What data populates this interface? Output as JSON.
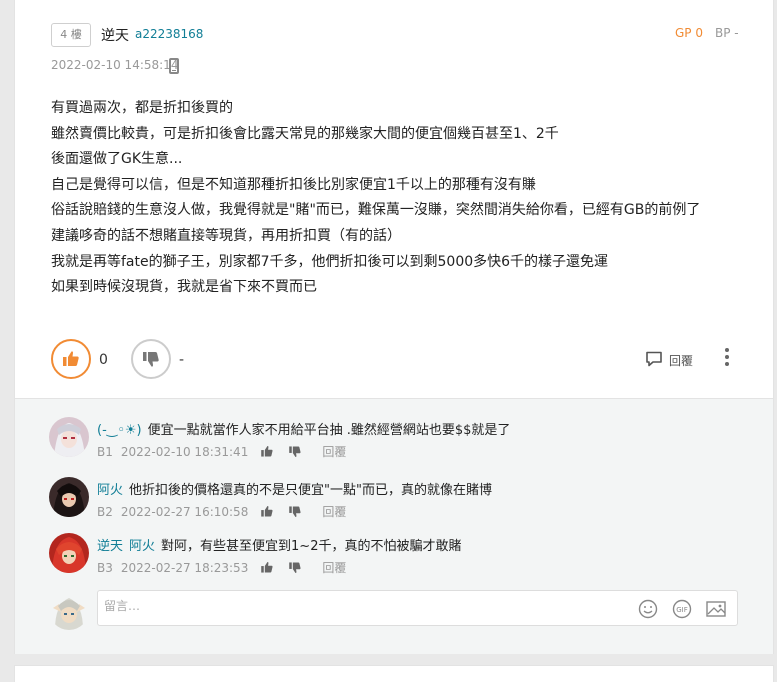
{
  "post": {
    "floor": "4 樓",
    "username": "逆天",
    "user_id": "a22238168",
    "gp": "GP 0",
    "bp": "BP -",
    "datetime": "2022-02-10 14:58:14",
    "lines": [
      "有買過兩次，都是折扣後買的",
      "雖然賣價比較貴，可是折扣後會比露天常見的那幾家大間的便宜個幾百甚至1、2千",
      "後面還做了GK生意...",
      "自己是覺得可以信，但是不知道那種折扣後比別家便宜1千以上的那種有沒有賺",
      "俗話說賠錢的生意沒人做，我覺得就是\"賭\"而已，難保萬一沒賺，突然間消失給你看，已經有GB的前例了",
      "建議哆奇的話不想賭直接等現貨，再用折扣買（有的話）",
      "我就是再等fate的獅子王，別家都7千多，他們折扣後可以到剩5000多快6千的樣子還免運",
      "如果到時候沒現貨，我就是省下來不買而已"
    ],
    "like_count": "0",
    "dislike_count": "-",
    "reply_label": "回覆"
  },
  "comments": [
    {
      "name": "(-‿◦☀)",
      "text": "便宜一點就當作人家不用給平台抽 .雖然經營網站也要$$就是了",
      "floor": "B1",
      "time": "2022-02-10 18:31:41",
      "reply": "回覆"
    },
    {
      "name": "阿火",
      "text": "他折扣後的價格還真的不是只便宜\"一點\"而已，真的就像在賭博",
      "floor": "B2",
      "time": "2022-02-27 16:10:58",
      "reply": "回覆"
    },
    {
      "name": "逆天",
      "mention": "阿火",
      "text": "對阿，有些甚至便宜到1~2千，真的不怕被騙才敢賭",
      "floor": "B3",
      "time": "2022-02-27 18:23:53",
      "reply": "回覆"
    }
  ],
  "reply_input": {
    "placeholder": "留言…"
  },
  "colors": {
    "accent": "#f18b34",
    "link": "#117e96",
    "comment_bg": "#f3f5f5"
  }
}
